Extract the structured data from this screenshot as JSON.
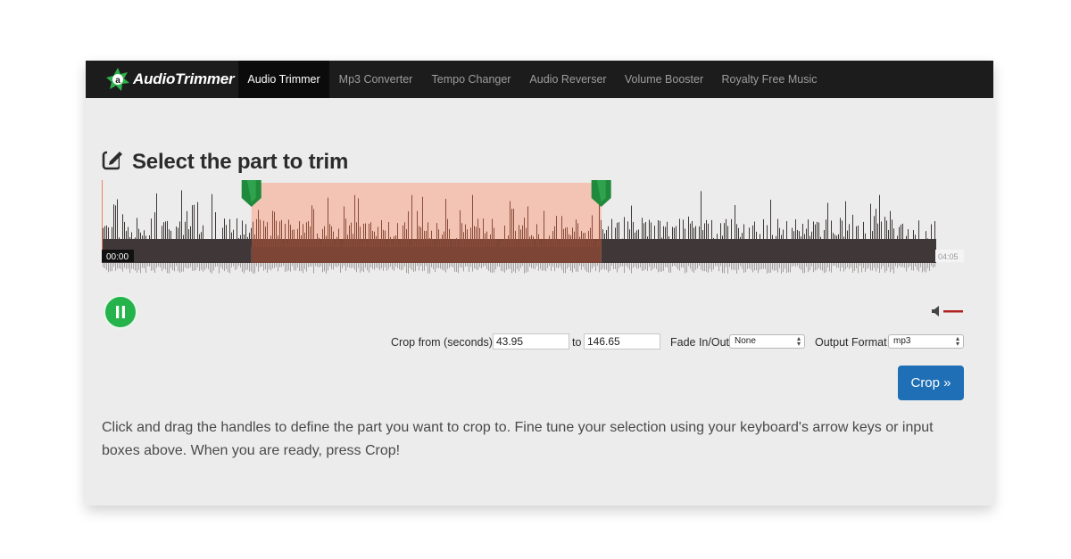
{
  "app": {
    "logo_text": "AudioTrimmer"
  },
  "nav": {
    "items": [
      {
        "label": "Audio Trimmer",
        "active": true
      },
      {
        "label": "Mp3 Converter",
        "active": false
      },
      {
        "label": "Tempo Changer",
        "active": false
      },
      {
        "label": "Audio Reverser",
        "active": false
      },
      {
        "label": "Volume Booster",
        "active": false
      },
      {
        "label": "Royalty Free Music",
        "active": false
      }
    ]
  },
  "page": {
    "title": "Select the part to trim",
    "title_icon": "edit-icon"
  },
  "player": {
    "time_start": "00:00",
    "time_end": "04:05",
    "selection_start_seconds": 43.95,
    "selection_end_seconds": 146.65,
    "duration_seconds": 245,
    "state_icon": "pause-icon",
    "volume_icon": "speaker-icon"
  },
  "crop": {
    "from_label": "Crop from (seconds):",
    "from_value": "43.95",
    "to_label": "to",
    "to_value": "146.65",
    "fade_label": "Fade In/Out",
    "fade_value": "None",
    "format_label": "Output Format",
    "format_value": "mp3",
    "button_label": "Crop »"
  },
  "help": {
    "text": "Click and drag the handles to define the part you want to crop to. Fine tune your selection using your keyboard's arrow keys or input boxes above. When you are ready, press Crop!"
  },
  "colors": {
    "nav_bg": "#1c1c1c",
    "selection": "#f3c4b3",
    "handle": "#1f8a3b",
    "play": "#26b34b",
    "crop_button": "#1e6fb5",
    "volume_bar": "#b22222"
  }
}
